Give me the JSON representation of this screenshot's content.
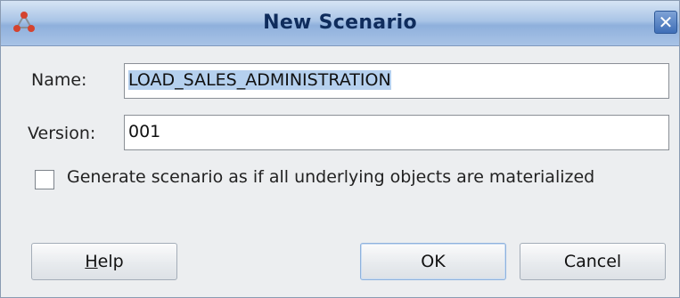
{
  "window": {
    "title": "New Scenario",
    "close_glyph": "✕"
  },
  "form": {
    "name_label": "Name:",
    "name_value": "LOAD_SALES_ADMINISTRATION",
    "version_label": "Version:",
    "version_value": "001",
    "materialize_label": "Generate scenario as if all underlying objects are materialized",
    "materialize_checked": false
  },
  "buttons": {
    "help_mnemonic": "H",
    "help_rest": "elp",
    "ok": "OK",
    "cancel": "Cancel"
  },
  "icons": {
    "app": "odi-scenario-icon",
    "close": "close-icon"
  },
  "colors": {
    "title_text": "#0f2c5c",
    "selection": "#b5d0ee",
    "icon_red": "#d4432f"
  }
}
